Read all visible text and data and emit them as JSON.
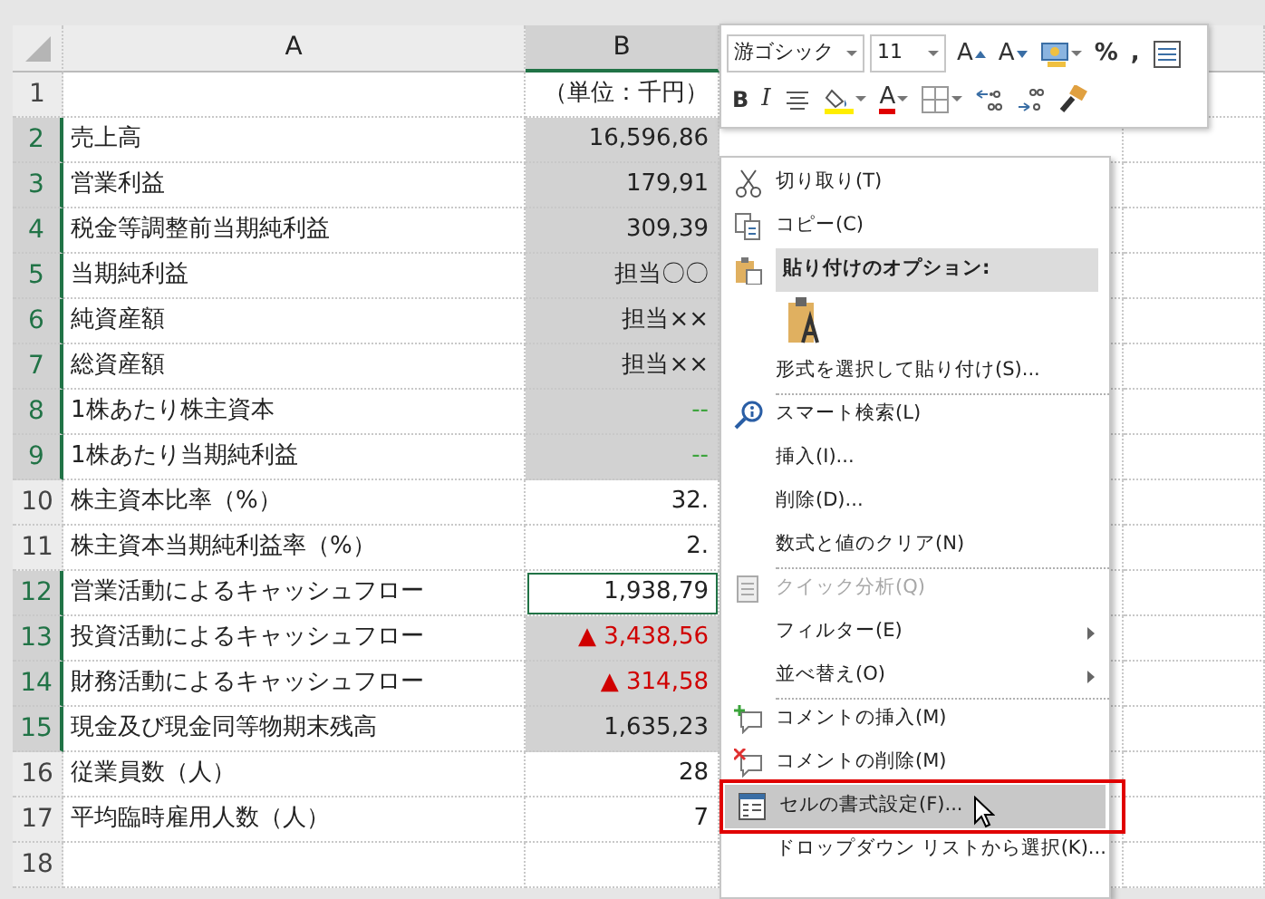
{
  "columns": [
    {
      "label": "A",
      "selected": false
    },
    {
      "label": "B",
      "selected": true
    }
  ],
  "rows": [
    {
      "number": "1",
      "selected": false,
      "active": false,
      "b": "（単位：千円）",
      "kind": "text"
    },
    {
      "number": "2",
      "selected": true,
      "active": false,
      "a": "売上高",
      "b": "16,596,86",
      "kind": "text"
    },
    {
      "number": "3",
      "selected": true,
      "active": false,
      "a": "営業利益",
      "b": "179,91",
      "kind": "text"
    },
    {
      "number": "4",
      "selected": true,
      "active": false,
      "a": "税金等調整前当期純利益",
      "b": "309,39",
      "kind": "text"
    },
    {
      "number": "5",
      "selected": true,
      "active": false,
      "a": "当期純利益",
      "b": "担当〇〇",
      "kind": "text"
    },
    {
      "number": "6",
      "selected": true,
      "active": false,
      "a": "純資産額",
      "b": "担当××",
      "kind": "text"
    },
    {
      "number": "7",
      "selected": true,
      "active": false,
      "a": "総資産額",
      "b": "担当××",
      "kind": "text"
    },
    {
      "number": "8",
      "selected": true,
      "active": false,
      "a": "1株あたり株主資本",
      "b": "--",
      "kind": "dash"
    },
    {
      "number": "9",
      "selected": true,
      "active": false,
      "a": "1株あたり当期純利益",
      "b": "--",
      "kind": "dash"
    },
    {
      "number": "10",
      "selected": false,
      "active": false,
      "a": "株主資本比率（%）",
      "b": "32.",
      "kind": "text"
    },
    {
      "number": "11",
      "selected": false,
      "active": false,
      "a": "株主資本当期純利益率（%）",
      "b": "2.",
      "kind": "text"
    },
    {
      "number": "12",
      "selected": true,
      "active": true,
      "a": "営業活動によるキャッシュフロー",
      "b": "1,938,79",
      "kind": "text"
    },
    {
      "number": "13",
      "selected": true,
      "active": false,
      "a": "投資活動によるキャッシュフロー",
      "b": "▲ 3,438,56",
      "kind": "negative"
    },
    {
      "number": "14",
      "selected": true,
      "active": false,
      "a": "財務活動によるキャッシュフロー",
      "b": "▲ 314,58",
      "kind": "negative"
    },
    {
      "number": "15",
      "selected": true,
      "active": false,
      "a": "現金及び現金同等物期末残高",
      "b": "1,635,23",
      "kind": "text"
    },
    {
      "number": "16",
      "selected": false,
      "active": false,
      "a": "従業員数（人）",
      "b": "28",
      "kind": "text"
    },
    {
      "number": "17",
      "selected": false,
      "active": false,
      "a": "平均臨時雇用人数（人）",
      "b": "7",
      "kind": "text"
    },
    {
      "number": "18",
      "selected": false,
      "active": false
    }
  ],
  "toolbar": {
    "font": "游ゴシック",
    "size": "11",
    "row1": [
      {
        "kind": "grow-font",
        "label": "A"
      },
      {
        "kind": "shrink-font",
        "label": "A"
      },
      {
        "kind": "accounting",
        "dropdown": true
      },
      {
        "kind": "text",
        "label": "%"
      },
      {
        "kind": "text",
        "label": ","
      },
      {
        "kind": "wrap"
      }
    ],
    "row2": [
      {
        "kind": "bold",
        "label": "B"
      },
      {
        "kind": "italic",
        "label": "I"
      },
      {
        "kind": "align"
      },
      {
        "kind": "fill",
        "dropdown": true
      },
      {
        "kind": "font-color",
        "label": "A",
        "dropdown": true
      },
      {
        "kind": "borders",
        "dropdown": true
      },
      {
        "kind": "inc-decimal"
      },
      {
        "kind": "dec-decimal"
      },
      {
        "kind": "painter"
      }
    ]
  },
  "menu": [
    {
      "kind": "cut",
      "label": "切り取り(T)",
      "selected": false,
      "disabled": false,
      "submenu": false,
      "separator_above": false,
      "annotated": false
    },
    {
      "kind": "copy",
      "label": "コピー(C)",
      "selected": false,
      "disabled": false,
      "submenu": false,
      "separator_above": false,
      "annotated": false
    },
    {
      "kind": "paste-header",
      "label": "貼り付けのオプション:"
    },
    {
      "kind": "paste-button"
    },
    {
      "kind": "plain",
      "label": "形式を選択して貼り付け(S)...",
      "selected": false,
      "disabled": false,
      "submenu": false,
      "separator_above": false,
      "annotated": false
    },
    {
      "kind": "smart-lookup",
      "label": "スマート検索(L)",
      "selected": false,
      "disabled": false,
      "submenu": false,
      "separator_above": true,
      "annotated": false
    },
    {
      "kind": "plain",
      "label": "挿入(I)...",
      "selected": false,
      "disabled": false,
      "submenu": false,
      "separator_above": false,
      "annotated": false
    },
    {
      "kind": "plain",
      "label": "削除(D)...",
      "selected": false,
      "disabled": false,
      "submenu": false,
      "separator_above": false,
      "annotated": false
    },
    {
      "kind": "plain",
      "label": "数式と値のクリア(N)",
      "selected": false,
      "disabled": false,
      "submenu": false,
      "separator_above": false,
      "annotated": false
    },
    {
      "kind": "quick-analysis",
      "label": "クイック分析(Q)",
      "selected": false,
      "disabled": true,
      "submenu": false,
      "separator_above": true,
      "annotated": false
    },
    {
      "kind": "plain",
      "label": "フィルター(E)",
      "selected": false,
      "disabled": false,
      "submenu": true,
      "separator_above": false,
      "annotated": false
    },
    {
      "kind": "plain",
      "label": "並べ替え(O)",
      "selected": false,
      "disabled": false,
      "submenu": true,
      "separator_above": false,
      "annotated": false
    },
    {
      "kind": "comment-insert",
      "label": "コメントの挿入(M)",
      "selected": false,
      "disabled": false,
      "submenu": false,
      "separator_above": true,
      "annotated": false
    },
    {
      "kind": "comment-delete",
      "label": "コメントの削除(M)",
      "selected": false,
      "disabled": false,
      "submenu": false,
      "separator_above": false,
      "annotated": false
    },
    {
      "kind": "format-cells",
      "label": "セルの書式設定(F)...",
      "selected": true,
      "disabled": false,
      "submenu": false,
      "separator_above": false,
      "annotated": true
    },
    {
      "kind": "plain",
      "label": "ドロップダウン リストから選択(K)...",
      "selected": false,
      "disabled": false,
      "submenu": false,
      "separator_above": false,
      "annotated": false
    }
  ]
}
